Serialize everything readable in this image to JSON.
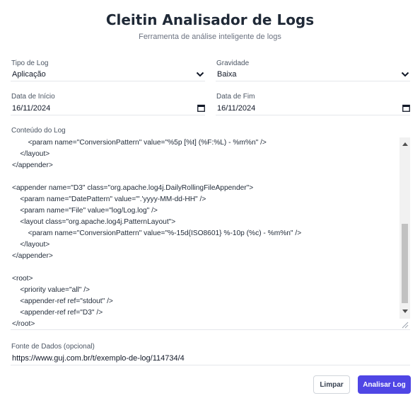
{
  "header": {
    "title": "Cleitin Analisador de Logs",
    "subtitle": "Ferramenta de análise inteligente de logs"
  },
  "form": {
    "log_type": {
      "label": "Tipo de Log",
      "value": "Aplicação"
    },
    "severity": {
      "label": "Gravidade",
      "value": "Baixa"
    },
    "start_date": {
      "label": "Data de Início",
      "value": "16/11/2024"
    },
    "end_date": {
      "label": "Data de Fim",
      "value": "16/11/2024"
    },
    "content": {
      "label": "Conteúdo do Log",
      "lines": [
        "        <param name=\"ConversionPattern\" value=\"%5p [%t] (%F:%L) - %m%n\" />",
        "    </layout>",
        "</appender>",
        "",
        "<appender name=\"D3\" class=\"org.apache.log4j.DailyRollingFileAppender\">",
        "    <param name=\"DatePattern\" value=\"'.'yyyy-MM-dd-HH\" />",
        "    <param name=\"File\" value=\"log/Log.log\" />",
        "    <layout class=\"org.apache.log4j.PatternLayout\">",
        "        <param name=\"ConversionPattern\" value=\"%-15d{ISO8601} %-10p (%c) - %m%n\" />",
        "    </layout>",
        "</appender>",
        "",
        "<root>",
        "    <priority value=\"all\" />",
        "    <appender-ref ref=\"stdout\" />",
        "    <appender-ref ref=\"D3\" />",
        "</root>"
      ]
    },
    "source": {
      "label": "Fonte de Dados (opcional)",
      "value": "https://www.guj.com.br/t/exemplo-de-log/114734/4"
    }
  },
  "actions": {
    "clear_label": "Limpar",
    "analyze_label": "Analisar Log"
  },
  "icons": {
    "select": "chevron-down-icon",
    "date": "calendar-icon"
  },
  "colors": {
    "accent": "#4f46e5",
    "title": "#1f2937"
  }
}
